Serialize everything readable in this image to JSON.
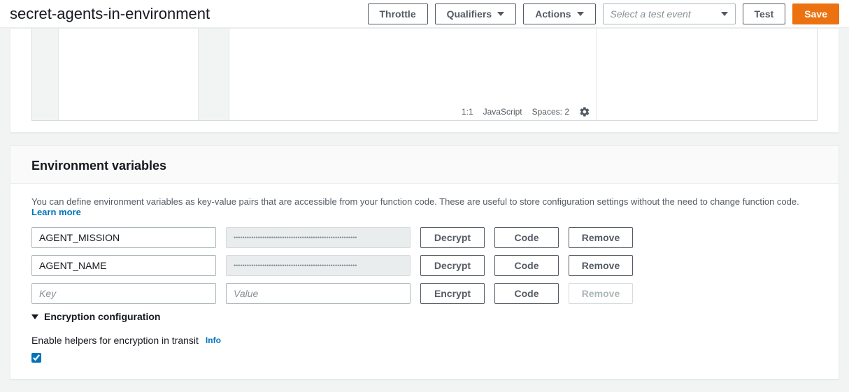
{
  "header": {
    "title": "secret-agents-in-environment",
    "throttle_label": "Throttle",
    "qualifiers_label": "Qualifiers",
    "actions_label": "Actions",
    "test_event_placeholder": "Select a test event",
    "test_label": "Test",
    "save_label": "Save"
  },
  "editor": {
    "status_cursor": "1:1",
    "status_language": "JavaScript",
    "status_spaces": "Spaces: 2"
  },
  "env_panel": {
    "title": "Environment variables",
    "description": "You can define environment variables as key-value pairs that are accessible from your function code. These are useful to store configuration settings without the need to change function code. ",
    "learn_more": "Learn more",
    "rows": [
      {
        "key": "AGENT_MISSION",
        "value_masked": "••••••••••••••••••••••••••••••••••••••••••••••••••••••••",
        "decrypt_label": "Decrypt",
        "code_label": "Code",
        "remove_label": "Remove"
      },
      {
        "key": "AGENT_NAME",
        "value_masked": "••••••••••••••••••••••••••••••••••••••••••••••••••••••••",
        "decrypt_label": "Decrypt",
        "code_label": "Code",
        "remove_label": "Remove"
      }
    ],
    "empty_row": {
      "key_placeholder": "Key",
      "value_placeholder": "Value",
      "encrypt_label": "Encrypt",
      "code_label": "Code",
      "remove_label": "Remove"
    },
    "encryption_config_label": "Encryption configuration",
    "enable_helpers_label": "Enable helpers for encryption in transit",
    "info_label": "Info",
    "enable_helpers_checked": true
  }
}
